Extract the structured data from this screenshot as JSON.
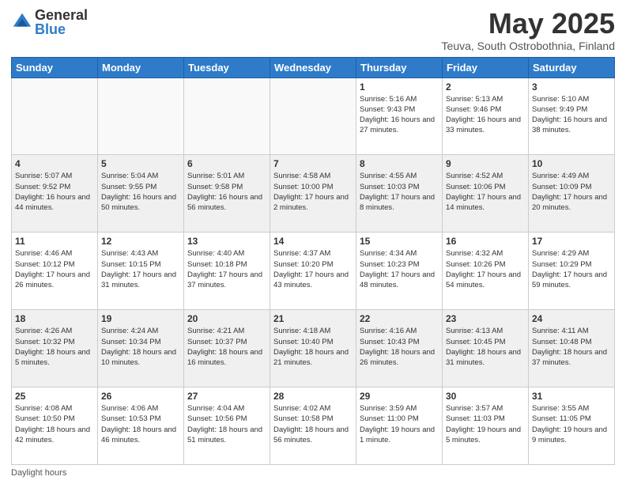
{
  "header": {
    "logo_general": "General",
    "logo_blue": "Blue",
    "month_title": "May 2025",
    "location": "Teuva, South Ostrobothnia, Finland"
  },
  "footer": {
    "note": "Daylight hours"
  },
  "weekdays": [
    "Sunday",
    "Monday",
    "Tuesday",
    "Wednesday",
    "Thursday",
    "Friday",
    "Saturday"
  ],
  "weeks": [
    [
      {
        "day": "",
        "info": ""
      },
      {
        "day": "",
        "info": ""
      },
      {
        "day": "",
        "info": ""
      },
      {
        "day": "",
        "info": ""
      },
      {
        "day": "1",
        "info": "Sunrise: 5:16 AM\nSunset: 9:43 PM\nDaylight: 16 hours\nand 27 minutes."
      },
      {
        "day": "2",
        "info": "Sunrise: 5:13 AM\nSunset: 9:46 PM\nDaylight: 16 hours\nand 33 minutes."
      },
      {
        "day": "3",
        "info": "Sunrise: 5:10 AM\nSunset: 9:49 PM\nDaylight: 16 hours\nand 38 minutes."
      }
    ],
    [
      {
        "day": "4",
        "info": "Sunrise: 5:07 AM\nSunset: 9:52 PM\nDaylight: 16 hours\nand 44 minutes."
      },
      {
        "day": "5",
        "info": "Sunrise: 5:04 AM\nSunset: 9:55 PM\nDaylight: 16 hours\nand 50 minutes."
      },
      {
        "day": "6",
        "info": "Sunrise: 5:01 AM\nSunset: 9:58 PM\nDaylight: 16 hours\nand 56 minutes."
      },
      {
        "day": "7",
        "info": "Sunrise: 4:58 AM\nSunset: 10:00 PM\nDaylight: 17 hours\nand 2 minutes."
      },
      {
        "day": "8",
        "info": "Sunrise: 4:55 AM\nSunset: 10:03 PM\nDaylight: 17 hours\nand 8 minutes."
      },
      {
        "day": "9",
        "info": "Sunrise: 4:52 AM\nSunset: 10:06 PM\nDaylight: 17 hours\nand 14 minutes."
      },
      {
        "day": "10",
        "info": "Sunrise: 4:49 AM\nSunset: 10:09 PM\nDaylight: 17 hours\nand 20 minutes."
      }
    ],
    [
      {
        "day": "11",
        "info": "Sunrise: 4:46 AM\nSunset: 10:12 PM\nDaylight: 17 hours\nand 26 minutes."
      },
      {
        "day": "12",
        "info": "Sunrise: 4:43 AM\nSunset: 10:15 PM\nDaylight: 17 hours\nand 31 minutes."
      },
      {
        "day": "13",
        "info": "Sunrise: 4:40 AM\nSunset: 10:18 PM\nDaylight: 17 hours\nand 37 minutes."
      },
      {
        "day": "14",
        "info": "Sunrise: 4:37 AM\nSunset: 10:20 PM\nDaylight: 17 hours\nand 43 minutes."
      },
      {
        "day": "15",
        "info": "Sunrise: 4:34 AM\nSunset: 10:23 PM\nDaylight: 17 hours\nand 48 minutes."
      },
      {
        "day": "16",
        "info": "Sunrise: 4:32 AM\nSunset: 10:26 PM\nDaylight: 17 hours\nand 54 minutes."
      },
      {
        "day": "17",
        "info": "Sunrise: 4:29 AM\nSunset: 10:29 PM\nDaylight: 17 hours\nand 59 minutes."
      }
    ],
    [
      {
        "day": "18",
        "info": "Sunrise: 4:26 AM\nSunset: 10:32 PM\nDaylight: 18 hours\nand 5 minutes."
      },
      {
        "day": "19",
        "info": "Sunrise: 4:24 AM\nSunset: 10:34 PM\nDaylight: 18 hours\nand 10 minutes."
      },
      {
        "day": "20",
        "info": "Sunrise: 4:21 AM\nSunset: 10:37 PM\nDaylight: 18 hours\nand 16 minutes."
      },
      {
        "day": "21",
        "info": "Sunrise: 4:18 AM\nSunset: 10:40 PM\nDaylight: 18 hours\nand 21 minutes."
      },
      {
        "day": "22",
        "info": "Sunrise: 4:16 AM\nSunset: 10:43 PM\nDaylight: 18 hours\nand 26 minutes."
      },
      {
        "day": "23",
        "info": "Sunrise: 4:13 AM\nSunset: 10:45 PM\nDaylight: 18 hours\nand 31 minutes."
      },
      {
        "day": "24",
        "info": "Sunrise: 4:11 AM\nSunset: 10:48 PM\nDaylight: 18 hours\nand 37 minutes."
      }
    ],
    [
      {
        "day": "25",
        "info": "Sunrise: 4:08 AM\nSunset: 10:50 PM\nDaylight: 18 hours\nand 42 minutes."
      },
      {
        "day": "26",
        "info": "Sunrise: 4:06 AM\nSunset: 10:53 PM\nDaylight: 18 hours\nand 46 minutes."
      },
      {
        "day": "27",
        "info": "Sunrise: 4:04 AM\nSunset: 10:56 PM\nDaylight: 18 hours\nand 51 minutes."
      },
      {
        "day": "28",
        "info": "Sunrise: 4:02 AM\nSunset: 10:58 PM\nDaylight: 18 hours\nand 56 minutes."
      },
      {
        "day": "29",
        "info": "Sunrise: 3:59 AM\nSunset: 11:00 PM\nDaylight: 19 hours\nand 1 minute."
      },
      {
        "day": "30",
        "info": "Sunrise: 3:57 AM\nSunset: 11:03 PM\nDaylight: 19 hours\nand 5 minutes."
      },
      {
        "day": "31",
        "info": "Sunrise: 3:55 AM\nSunset: 11:05 PM\nDaylight: 19 hours\nand 9 minutes."
      }
    ]
  ]
}
